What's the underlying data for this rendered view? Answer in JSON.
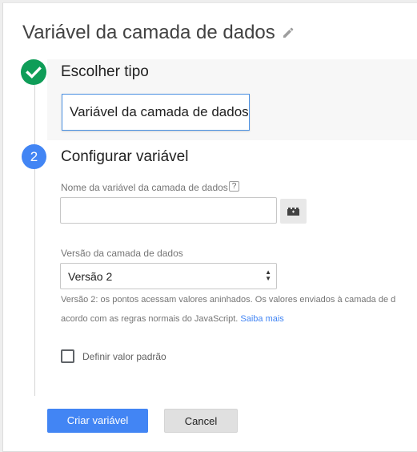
{
  "header": {
    "title": "Variável da camada de dados"
  },
  "step1": {
    "title": "Escolher tipo",
    "selected_type": "Variável da camada de dados"
  },
  "step2": {
    "number": "2",
    "title": "Configurar variável",
    "name_field": {
      "label": "Nome da variável da camada de dados",
      "help": "?",
      "value": "",
      "placeholder": ""
    },
    "version_field": {
      "label": "Versão da camada de dados",
      "selected": "Versão 2"
    },
    "description": {
      "line1": "Versão 2: os pontos acessam valores aninhados. Os valores enviados à camada de d",
      "line2": "acordo com as regras normais do JavaScript.",
      "link": "Saiba mais"
    },
    "default_value": {
      "label": "Definir valor padrão",
      "checked": false
    }
  },
  "footer": {
    "create_label": "Criar variável",
    "cancel_label": "Cancel"
  },
  "colors": {
    "accent": "#4285f4",
    "success": "#0f9d58"
  },
  "icons": {
    "title_edit": "pencil-icon",
    "step1_status": "check-icon",
    "variable_picker": "lego-brick-icon"
  }
}
